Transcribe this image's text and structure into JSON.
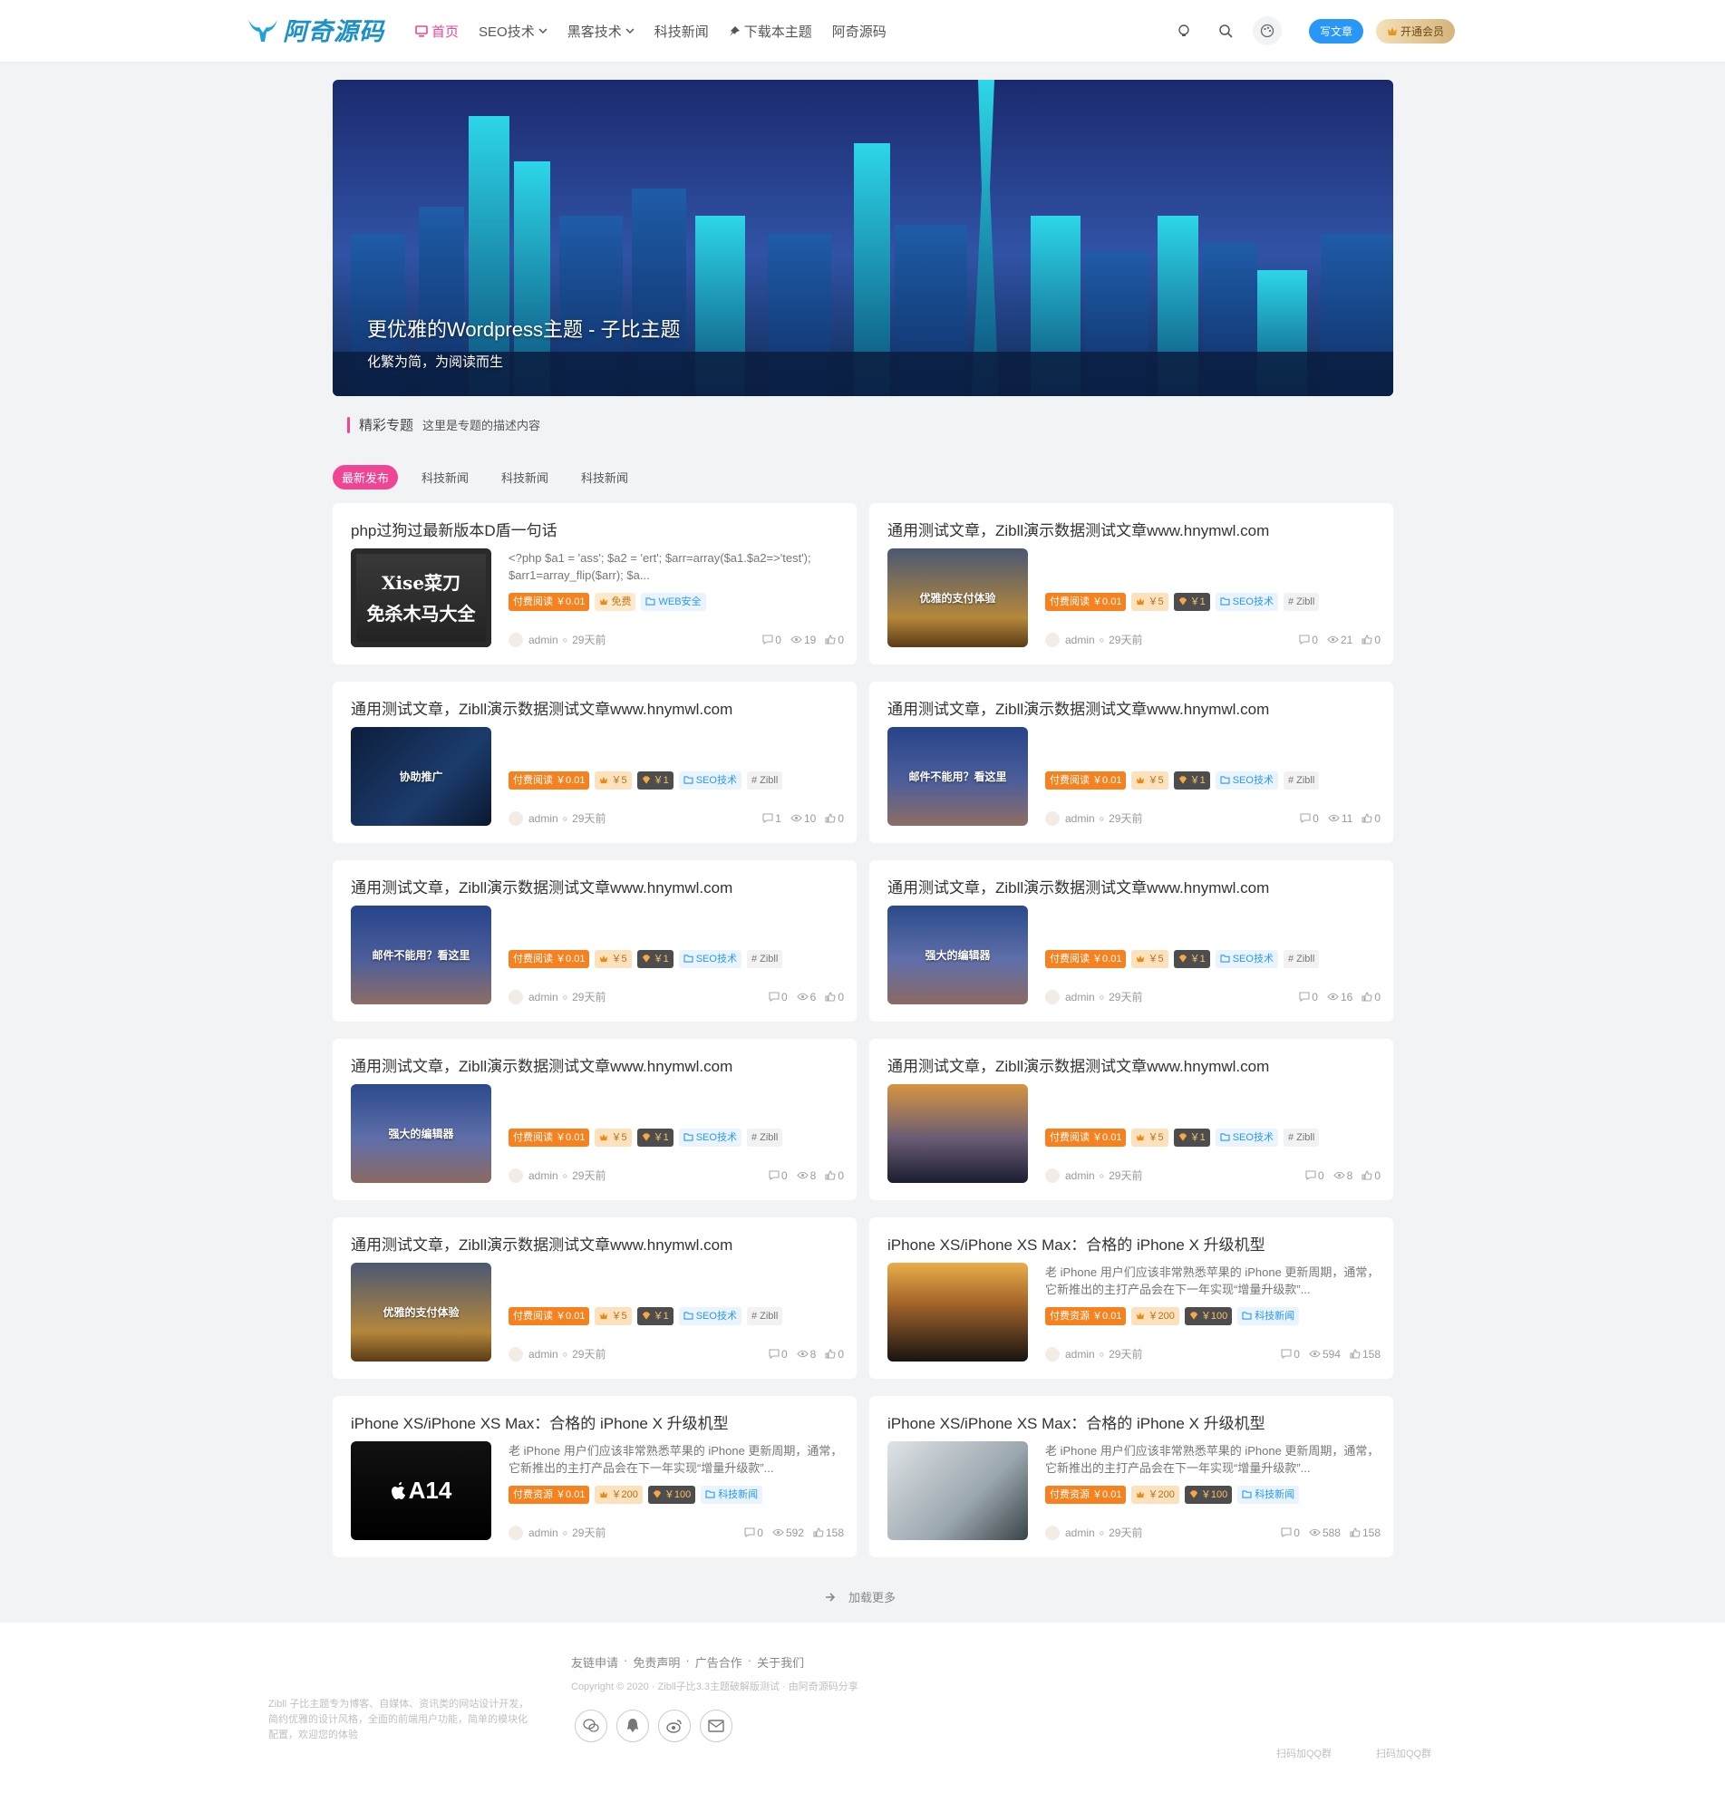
{
  "site": {
    "logo_text": "阿奇源码"
  },
  "nav": {
    "items": [
      {
        "label": "首页"
      },
      {
        "label": "SEO技术"
      },
      {
        "label": "黑客技术"
      },
      {
        "label": "科技新闻"
      },
      {
        "label": "下载本主题"
      },
      {
        "label": "阿奇源码"
      }
    ],
    "write_label": "写文章",
    "vip_label": "开通会员"
  },
  "banner": {
    "title": "更优雅的Wordpress主题 - 子比主题",
    "subtitle": "化繁为简，为阅读而生"
  },
  "topic": {
    "title": "精彩专题",
    "desc": "这里是专题的描述内容"
  },
  "tabs": [
    "最新发布",
    "科技新闻",
    "科技新闻",
    "科技新闻"
  ],
  "cards": [
    {
      "title": "php过狗过最新版本D盾一句话",
      "excerpt": "<?php $a1 = 'ass'; $a2 = 'ert'; $arr=array($a1.$a2=>'test'); $arr1=array_flip($arr); $a...",
      "thumb_text1": "Xise菜刀",
      "thumb_text2": "免杀木马大全",
      "badges": [
        "付费阅读 ￥0.01",
        "免费",
        "WEB安全"
      ],
      "author": "admin",
      "time": "29天前",
      "comments": "0",
      "views": "19",
      "likes": "0"
    },
    {
      "title": "通用测试文章，Zibll演示数据测试文章www.hnymwl.com",
      "thumb_text1": "优雅的支付体验",
      "badges": [
        "付费阅读 ￥0.01",
        "￥5",
        "￥1",
        "SEO技术",
        "# Zibll"
      ],
      "author": "admin",
      "time": "29天前",
      "comments": "0",
      "views": "21",
      "likes": "0"
    },
    {
      "title": "通用测试文章，Zibll演示数据测试文章www.hnymwl.com",
      "thumb_text1": "协助推广",
      "badges": [
        "付费阅读 ￥0.01",
        "￥5",
        "￥1",
        "SEO技术",
        "# Zibll"
      ],
      "author": "admin",
      "time": "29天前",
      "comments": "1",
      "views": "10",
      "likes": "0"
    },
    {
      "title": "通用测试文章，Zibll演示数据测试文章www.hnymwl.com",
      "thumb_text1": "邮件不能用？看这里",
      "badges": [
        "付费阅读 ￥0.01",
        "￥5",
        "￥1",
        "SEO技术",
        "# Zibll"
      ],
      "author": "admin",
      "time": "29天前",
      "comments": "0",
      "views": "11",
      "likes": "0"
    },
    {
      "title": "通用测试文章，Zibll演示数据测试文章www.hnymwl.com",
      "thumb_text1": "邮件不能用？看这里",
      "badges": [
        "付费阅读 ￥0.01",
        "￥5",
        "￥1",
        "SEO技术",
        "# Zibll"
      ],
      "author": "admin",
      "time": "29天前",
      "comments": "0",
      "views": "6",
      "likes": "0"
    },
    {
      "title": "通用测试文章，Zibll演示数据测试文章www.hnymwl.com",
      "thumb_text1": "强大的编辑器",
      "badges": [
        "付费阅读 ￥0.01",
        "￥5",
        "￥1",
        "SEO技术",
        "# Zibll"
      ],
      "author": "admin",
      "time": "29天前",
      "comments": "0",
      "views": "16",
      "likes": "0"
    },
    {
      "title": "通用测试文章，Zibll演示数据测试文章www.hnymwl.com",
      "thumb_text1": "强大的编辑器",
      "badges": [
        "付费阅读 ￥0.01",
        "￥5",
        "￥1",
        "SEO技术",
        "# Zibll"
      ],
      "author": "admin",
      "time": "29天前",
      "comments": "0",
      "views": "8",
      "likes": "0"
    },
    {
      "title": "通用测试文章，Zibll演示数据测试文章www.hnymwl.com",
      "thumb_text1": "",
      "badges": [
        "付费阅读 ￥0.01",
        "￥5",
        "￥1",
        "SEO技术",
        "# Zibll"
      ],
      "author": "admin",
      "time": "29天前",
      "comments": "0",
      "views": "8",
      "likes": "0"
    },
    {
      "title": "通用测试文章，Zibll演示数据测试文章www.hnymwl.com",
      "thumb_text1": "优雅的支付体验",
      "badges": [
        "付费阅读 ￥0.01",
        "￥5",
        "￥1",
        "SEO技术",
        "# Zibll"
      ],
      "author": "admin",
      "time": "29天前",
      "comments": "0",
      "views": "8",
      "likes": "0"
    },
    {
      "title": "iPhone XS/iPhone XS Max：合格的 iPhone X 升级机型",
      "excerpt": "老 iPhone 用户们应该非常熟悉苹果的 iPhone 更新周期，通常，它新推出的主打产品会在下一年实现“增量升级款”...",
      "thumb_text1": "",
      "badges": [
        "付费资源 ￥0.01",
        "￥200",
        "￥100",
        "科技新闻"
      ],
      "author": "admin",
      "time": "29天前",
      "comments": "0",
      "views": "594",
      "likes": "158"
    },
    {
      "title": "iPhone XS/iPhone XS Max：合格的 iPhone X 升级机型",
      "excerpt": "老 iPhone 用户们应该非常熟悉苹果的 iPhone 更新周期，通常，它新推出的主打产品会在下一年实现“增量升级款”...",
      "thumb_text1": "A14",
      "badges": [
        "付费资源 ￥0.01",
        "￥200",
        "￥100",
        "科技新闻"
      ],
      "author": "admin",
      "time": "29天前",
      "comments": "0",
      "views": "592",
      "likes": "158"
    },
    {
      "title": "iPhone XS/iPhone XS Max：合格的 iPhone X 升级机型",
      "excerpt": "老 iPhone 用户们应该非常熟悉苹果的 iPhone 更新周期，通常，它新推出的主打产品会在下一年实现“增量升级款”...",
      "thumb_text1": "",
      "badges": [
        "付费资源 ￥0.01",
        "￥200",
        "￥100",
        "科技新闻"
      ],
      "author": "admin",
      "time": "29天前",
      "comments": "0",
      "views": "588",
      "likes": "158"
    }
  ],
  "load_more": "加载更多",
  "footer": {
    "desc": "Zibll 子比主题专为博客、自媒体、资讯类的网站设计开发，简约优雅的设计风格，全面的前端用户功能，简单的模块化配置，欢迎您的体验",
    "links": [
      "友链申请",
      "免责声明",
      "广告合作",
      "关于我们"
    ],
    "copyright": "Copyright © 2020 · Zibll子比3.3主题破解版测试 · 由阿奇源码分享",
    "qr1": "扫码加QQ群",
    "qr2": "扫码加QQ群"
  }
}
